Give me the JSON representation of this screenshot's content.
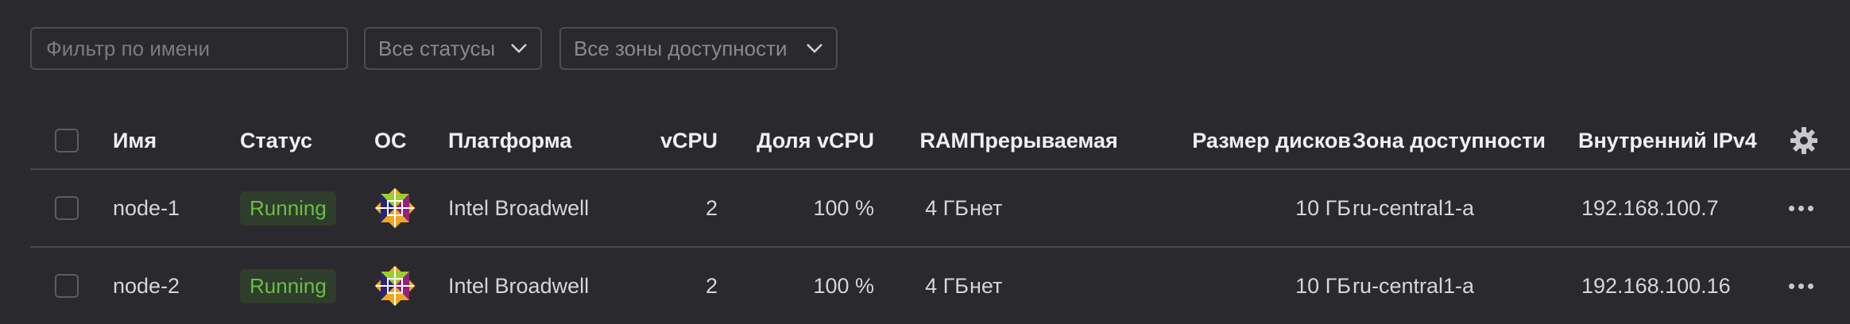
{
  "filters": {
    "name_placeholder": "Фильтр по имени",
    "status_select": "Все статусы",
    "zone_select": "Все зоны доступности"
  },
  "table": {
    "columns": {
      "name": "Имя",
      "status": "Статус",
      "os": "ОС",
      "platform": "Платформа",
      "vcpu": "vCPU",
      "vcpu_share": "Доля vCPU",
      "ram": "RAM",
      "preemptible": "Прерываемая",
      "disk_size": "Размер дисков",
      "zone": "Зона доступности",
      "internal_ipv4": "Внутренний IPv4"
    },
    "settings_icon": "gear-icon",
    "rows": [
      {
        "name": "node-1",
        "status": "Running",
        "os_icon": "centos-logo",
        "platform": "Intel Broadwell",
        "vcpu": "2",
        "vcpu_share": "100 %",
        "ram": "4 ГБ",
        "preemptible": "нет",
        "disk_size": "10 ГБ",
        "zone": "ru-central1-a",
        "internal_ipv4": "192.168.100.7"
      },
      {
        "name": "node-2",
        "status": "Running",
        "os_icon": "centos-logo",
        "platform": "Intel Broadwell",
        "vcpu": "2",
        "vcpu_share": "100 %",
        "ram": "4 ГБ",
        "preemptible": "нет",
        "disk_size": "10 ГБ",
        "zone": "ru-central1-a",
        "internal_ipv4": "192.168.100.16"
      }
    ]
  },
  "colors": {
    "background": "#2a292e",
    "running_text": "#6cbd45",
    "running_bg": "#2f3d2c",
    "divider": "#48474d"
  }
}
